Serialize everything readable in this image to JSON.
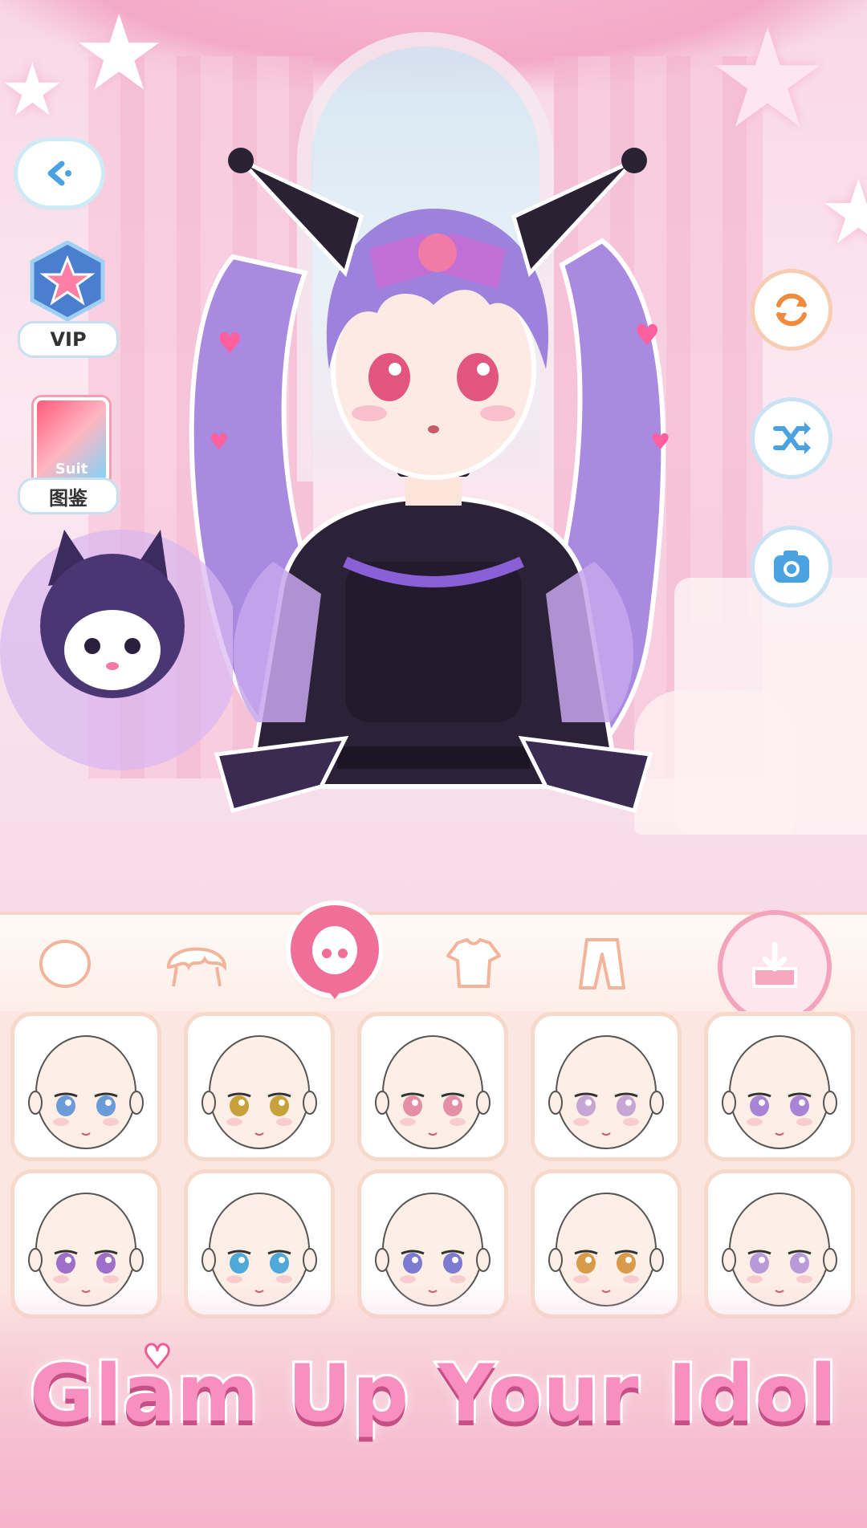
{
  "left_panel": {
    "vip_label": "VIP",
    "suit_badge": "Suit",
    "collection_label": "图鉴"
  },
  "banner": {
    "title": "Glam Up Your Idol"
  },
  "categories": [
    {
      "name": "face-base",
      "icon": "head-icon",
      "active": false
    },
    {
      "name": "hair",
      "icon": "hair-icon",
      "active": false
    },
    {
      "name": "face",
      "icon": "face-icon",
      "active": true
    },
    {
      "name": "top",
      "icon": "shirt-icon",
      "active": false
    },
    {
      "name": "bottom",
      "icon": "pants-icon",
      "active": false
    }
  ],
  "face_options": [
    {
      "eye_color": "#6b9bd8"
    },
    {
      "eye_color": "#c9a13a"
    },
    {
      "eye_color": "#e58fa6"
    },
    {
      "eye_color": "#c7a5d4"
    },
    {
      "eye_color": "#a883d6"
    },
    {
      "eye_color": "#9e6fc8"
    },
    {
      "eye_color": "#4fa8d8"
    },
    {
      "eye_color": "#7d7ad2"
    },
    {
      "eye_color": "#d99a4a"
    },
    {
      "eye_color": "#b99ad8"
    }
  ],
  "colors": {
    "accent_pink": "#ef6f98",
    "banner_text": "#f790bf",
    "refresh_orange": "#f08a3c",
    "blue_icon": "#4aa3e0"
  }
}
